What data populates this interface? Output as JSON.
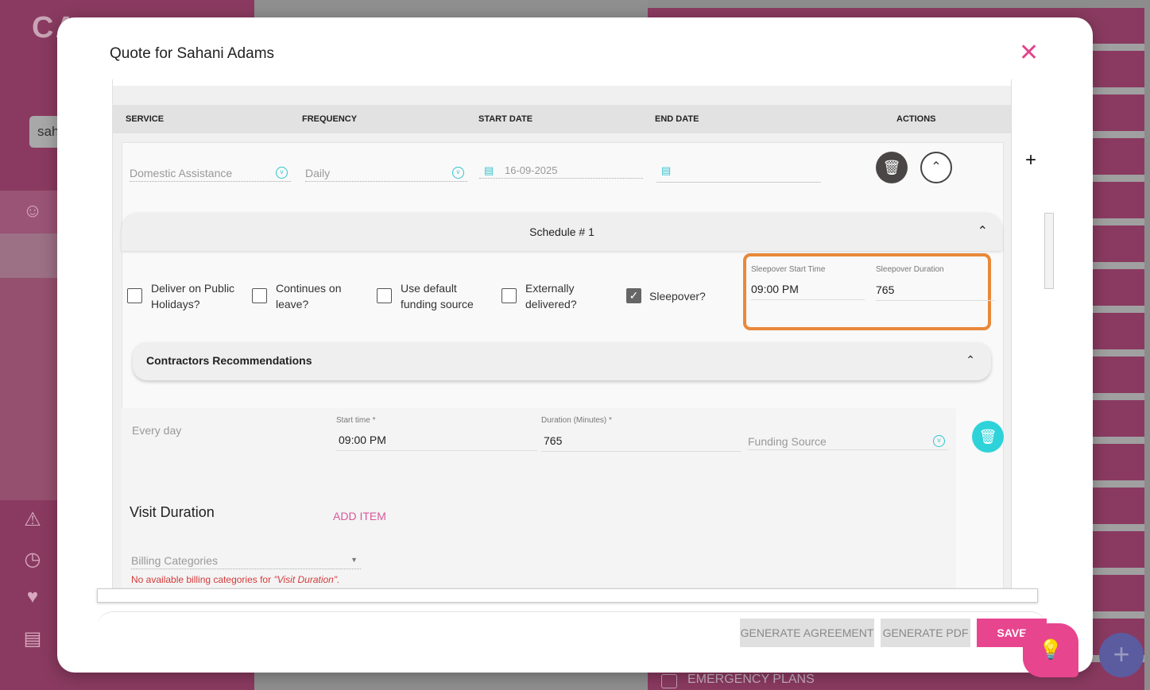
{
  "background": {
    "logo": "CA",
    "search_value": "sah",
    "emergency_label": "EMERGENCY PLANS"
  },
  "modal": {
    "title": "Quote for Sahani Adams",
    "table_headers": {
      "service": "SERVICE",
      "frequency": "FREQUENCY",
      "start_date": "START DATE",
      "end_date": "END DATE",
      "actions": "ACTIONS"
    },
    "row": {
      "service": "Domestic Assistance",
      "frequency": "Daily",
      "start_date": "16-09-2025",
      "end_date": ""
    },
    "schedule": {
      "title": "Schedule # 1",
      "checkboxes": [
        {
          "label": "Deliver on Public Holidays?",
          "checked": false
        },
        {
          "label": "Continues on leave?",
          "checked": false
        },
        {
          "label": "Use default funding source",
          "checked": false
        },
        {
          "label": "Externally delivered?",
          "checked": false
        },
        {
          "label": "Sleepover?",
          "checked": true
        }
      ],
      "sleepover_start_label": "Sleepover Start Time",
      "sleepover_start_value": "09:00 PM",
      "sleepover_duration_label": "Sleepover Duration",
      "sleepover_duration_value": "765",
      "contractors_title": "Contractors Recommendations",
      "day": "Every day",
      "start_time_label": "Start time *",
      "start_time_value": "09:00 PM",
      "duration_label": "Duration (Minutes) *",
      "duration_value": "765",
      "funding_placeholder": "Funding Source",
      "visit_duration": "Visit Duration",
      "add_item": "ADD ITEM",
      "billing_placeholder": "Billing Categories",
      "billing_error_prefix": "No available billing categories for ",
      "billing_error_name": "\"Visit Duration\"."
    },
    "footer": {
      "generate_agreement": "GENERATE AGREEMENT",
      "generate_pdf": "GENERATE PDF",
      "save": "SAVE"
    }
  },
  "colors": {
    "brand_pink": "#e8458f",
    "teal": "#2ec6cf",
    "highlight": "#e8893a",
    "sidebar": "#8a3a60"
  }
}
